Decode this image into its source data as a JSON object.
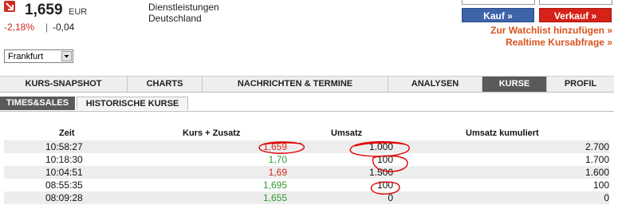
{
  "quote": {
    "price": "1,659",
    "currency": "EUR",
    "change_pct": "-2,18%",
    "separator": "|",
    "change_abs": "-0,04",
    "direction_icon": "down-arrow-icon",
    "info_line1": "Dienstleistungen",
    "info_line2": "Deutschland"
  },
  "exchange_select": {
    "value": "Frankfurt"
  },
  "actions": {
    "buy_label": "Kauf »",
    "sell_label": "Verkauf »",
    "watchlist_link": "Zur Watchlist hinzufügen »",
    "realtime_link": "Realtime Kursabfrage »"
  },
  "tabs": [
    {
      "label": "KURS-SNAPSHOT"
    },
    {
      "label": "CHARTS"
    },
    {
      "label": "NACHRICHTEN & TERMINE"
    },
    {
      "label": "ANALYSEN"
    },
    {
      "label": "KURSE"
    },
    {
      "label": "PROFIL"
    }
  ],
  "subtabs": [
    {
      "label": "TIMES&SALES"
    },
    {
      "label": "HISTORISCHE KURSE"
    }
  ],
  "table": {
    "headers": [
      "Zeit",
      "Kurs + Zusatz",
      "Umsatz",
      "Umsatz kumuliert"
    ],
    "rows": [
      {
        "zeit": "10:58:27",
        "kurs": "1,659",
        "umsatz": "1.000",
        "kumuliert": "2.700"
      },
      {
        "zeit": "10:18:30",
        "kurs": "1,70",
        "umsatz": "100",
        "kumuliert": "1.700"
      },
      {
        "zeit": "10:04:51",
        "kurs": "1,69",
        "umsatz": "1.500",
        "kumuliert": "1.600"
      },
      {
        "zeit": "08:55:35",
        "kurs": "1,695",
        "umsatz": "100",
        "kumuliert": "100"
      },
      {
        "zeit": "08:09:28",
        "kurs": "1,655",
        "umsatz": "0",
        "kumuliert": "0"
      }
    ]
  },
  "colors": {
    "down": "#d32a1f",
    "up": "#2e9a2e",
    "buy": "#3d63a8",
    "sell": "#d62219",
    "link": "#d9541c",
    "active_tab": "#5a5a5a",
    "annotation": "#e00000"
  }
}
